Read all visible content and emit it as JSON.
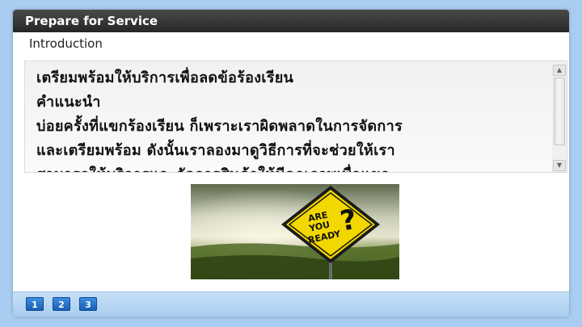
{
  "window": {
    "title": "Prepare for Service",
    "subtitle": "Introduction"
  },
  "content": {
    "lines": [
      "เตรียมพร้อมให้บริการเพื่อลดข้อร้องเรียน",
      "คำแนะนำ",
      "บ่อยครั้งที่แขกร้องเรียน  ก็เพราะเราผิดพลาดในการจัดการ",
      "และเตรียมพร้อม   ดังนั้นเราลองมาดูวิธีการที่จะช่วยให้เรา",
      "สามารถให้บริการและจัดการสินค้าให้มีคุณภาพเพื่อแขก"
    ]
  },
  "image": {
    "sign_text": [
      "ARE",
      "YOU",
      "READY"
    ],
    "sign_symbol": "?",
    "sign_color": "#f3d800"
  },
  "pager": {
    "pages": [
      "1",
      "2",
      "3"
    ]
  },
  "icons": {
    "scroll_up": "triangle-up-icon",
    "scroll_down": "triangle-down-icon"
  }
}
